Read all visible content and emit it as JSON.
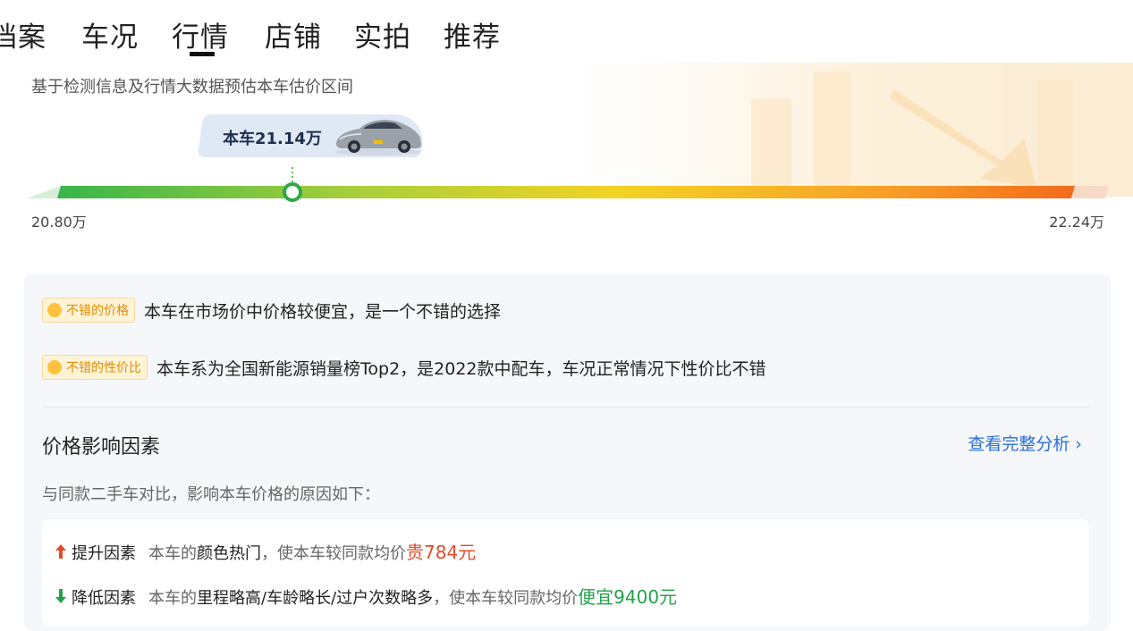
{
  "nav": {
    "tabs": [
      "档案",
      "车况",
      "行情",
      "店铺",
      "实拍",
      "推荐"
    ],
    "active": "行情"
  },
  "estimate": {
    "subtitle": "基于检测信息及行情大数据预估本车估价区间",
    "car_label": "本车21.14万",
    "range_min": "20.80万",
    "range_max": "22.24万",
    "car_price_value": 21.14,
    "min_value": 20.8,
    "max_value": 22.24
  },
  "highlights": [
    {
      "badge": "不错的价格",
      "text": "本车在市场价中价格较便宜，是一个不错的选择"
    },
    {
      "badge": "不错的性价比",
      "text": "本车系为全国新能源销量榜Top2，是2022款中配车，车况正常情况下性价比不错"
    }
  ],
  "factors": {
    "title": "价格影响因素",
    "link": "查看完整分析 ›",
    "desc": "与同款二手车对比，影响本车价格的原因如下：",
    "up": {
      "head": "提升因素",
      "prefix": "本车的",
      "item": "颜色热门",
      "mid": "，使本车较同款均价",
      "result": "贵784元"
    },
    "down": {
      "head": "降低因素",
      "prefix": "本车的",
      "item": "里程略高/车龄略长/过户次数略多",
      "mid": "，使本车较同款均价",
      "result": "便宜9400元"
    }
  },
  "colors": {
    "accent_blue": "#2a6fdb",
    "up_red": "#e34b2c",
    "down_green": "#22a34a",
    "badge_orange": "#e68a00"
  }
}
